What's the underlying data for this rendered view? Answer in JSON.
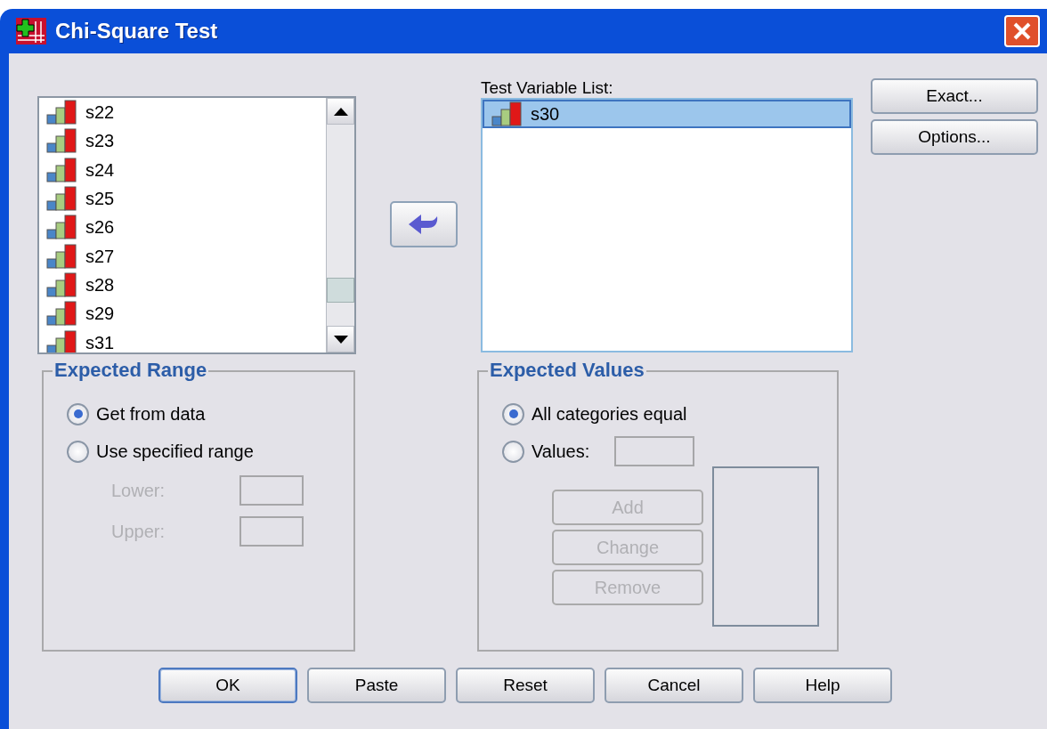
{
  "window": {
    "title": "Chi-Square Test"
  },
  "source_list": {
    "items": [
      {
        "name": "s22",
        "selected": false
      },
      {
        "name": "s23",
        "selected": false
      },
      {
        "name": "s24",
        "selected": false
      },
      {
        "name": "s25",
        "selected": false
      },
      {
        "name": "s26",
        "selected": false
      },
      {
        "name": "s27",
        "selected": false
      },
      {
        "name": "s28",
        "selected": false
      },
      {
        "name": "s29",
        "selected": false
      },
      {
        "name": "s31",
        "selected": false
      }
    ]
  },
  "test_variable_list": {
    "label": "Test Variable List:",
    "items": [
      {
        "name": "s30",
        "selected": true
      }
    ]
  },
  "side_buttons": [
    {
      "label": "Exact..."
    },
    {
      "label": "Options..."
    }
  ],
  "expected_range": {
    "title": "Expected Range",
    "options": [
      {
        "label": "Get from data",
        "selected": true
      },
      {
        "label": "Use specified range",
        "selected": false
      }
    ],
    "fields": [
      {
        "label": "Lower:",
        "disabled": true
      },
      {
        "label": "Upper:",
        "disabled": true
      }
    ]
  },
  "expected_values": {
    "title": "Expected Values",
    "options": [
      {
        "label": "All categories equal",
        "selected": true
      },
      {
        "label": "Values:",
        "selected": false
      }
    ],
    "value_buttons": [
      {
        "label": "Add",
        "disabled": true
      },
      {
        "label": "Change",
        "disabled": true
      },
      {
        "label": "Remove",
        "disabled": true
      }
    ]
  },
  "buttons": [
    {
      "label": "OK",
      "default": true
    },
    {
      "label": "Paste",
      "default": false
    },
    {
      "label": "Reset",
      "default": false
    },
    {
      "label": "Cancel",
      "default": false
    },
    {
      "label": "Help",
      "default": false
    }
  ]
}
